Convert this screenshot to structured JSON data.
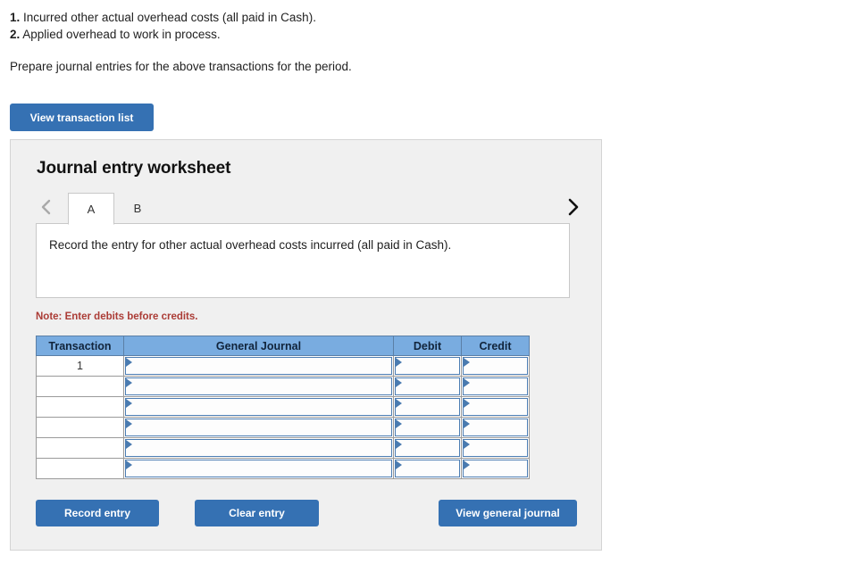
{
  "prompt": {
    "items": [
      {
        "num": "1.",
        "text": " Incurred other actual overhead costs (all paid in Cash)."
      },
      {
        "num": "2.",
        "text": " Applied overhead to work in process."
      }
    ],
    "instruction": "Prepare journal entries for the above transactions for the period."
  },
  "toolbar": {
    "view_transaction_list_label": "View transaction list"
  },
  "worksheet": {
    "title": "Journal entry worksheet",
    "nav": {
      "prev_icon": "chevron-left-icon",
      "next_icon": "chevron-right-icon"
    },
    "tabs": [
      {
        "label": "A",
        "active": true
      },
      {
        "label": "B",
        "active": false
      }
    ],
    "description": "Record the entry for other actual overhead costs incurred (all paid in Cash).",
    "note": "Note: Enter debits before credits.",
    "table": {
      "columns": [
        "Transaction",
        "General Journal",
        "Debit",
        "Credit"
      ],
      "rows": [
        {
          "transaction": "1",
          "general_journal": "",
          "debit": "",
          "credit": ""
        },
        {
          "transaction": "",
          "general_journal": "",
          "debit": "",
          "credit": ""
        },
        {
          "transaction": "",
          "general_journal": "",
          "debit": "",
          "credit": ""
        },
        {
          "transaction": "",
          "general_journal": "",
          "debit": "",
          "credit": ""
        },
        {
          "transaction": "",
          "general_journal": "",
          "debit": "",
          "credit": ""
        },
        {
          "transaction": "",
          "general_journal": "",
          "debit": "",
          "credit": ""
        }
      ]
    },
    "actions": {
      "record_entry_label": "Record entry",
      "clear_entry_label": "Clear entry",
      "view_general_journal_label": "View general journal"
    }
  },
  "colors": {
    "button_blue": "#3571b3",
    "header_blue": "#79ace0",
    "note_red": "#ab3c36",
    "panel_bg": "#f0f0f0",
    "cell_border_blue": "#4c7db3"
  }
}
